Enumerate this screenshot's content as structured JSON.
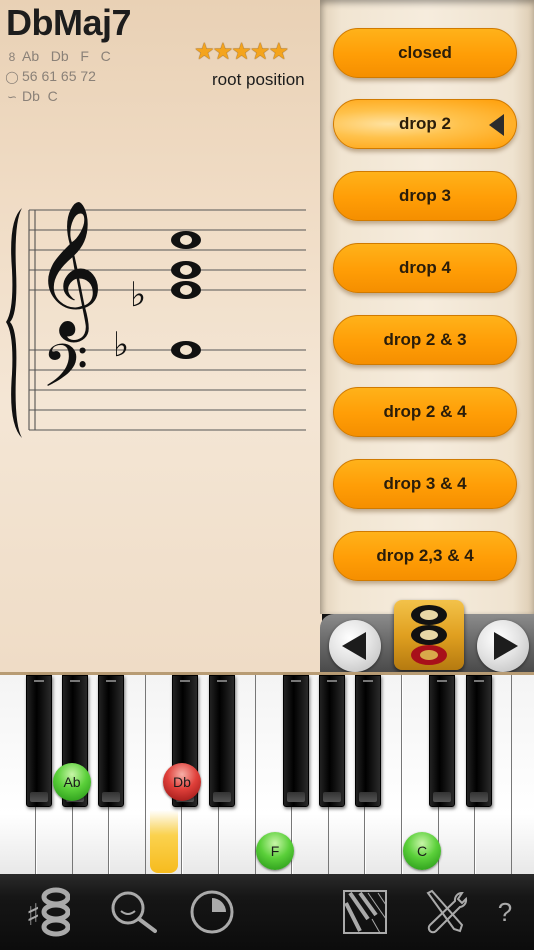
{
  "chord": {
    "name": "DbMaj7",
    "note_names": "Ab   Db   F   C",
    "midi_numbers": "56 61 65 72",
    "bass_notes": "Db  C",
    "rating_stars": 5,
    "rating_max": 5,
    "stars_text": "★★★★★",
    "inversion": "root position"
  },
  "icons": {
    "notes_row": "chord-notes-icon",
    "midi_row": "midi-icon",
    "bass_row": "bass-notes-icon"
  },
  "staff": {
    "treble_accidental": "♭",
    "bass_accidental": "♭"
  },
  "voicings": {
    "selected": "drop 2",
    "items": [
      {
        "label": "closed"
      },
      {
        "label": "drop 2"
      },
      {
        "label": "drop 3"
      },
      {
        "label": "drop 4"
      },
      {
        "label": "drop 2 & 3"
      },
      {
        "label": "drop 2 & 4"
      },
      {
        "label": "drop 3 & 4"
      },
      {
        "label": "drop 2,3 & 4"
      }
    ]
  },
  "keyboard": {
    "markers": [
      {
        "note": "Ab",
        "color": "#3fbf2a"
      },
      {
        "note": "Db",
        "color": "#d8322c"
      },
      {
        "note": "F",
        "color": "#3fbf2a"
      },
      {
        "note": "C",
        "color": "#3fbf2a"
      }
    ],
    "highlight_color": "#f6bb1e"
  },
  "toolbar": {
    "help_label": "?"
  },
  "colors": {
    "button_orange": "#ff9d06",
    "star_orange": "#f4a41d",
    "root_red": "#d8322c",
    "note_green": "#3fbf2a"
  }
}
